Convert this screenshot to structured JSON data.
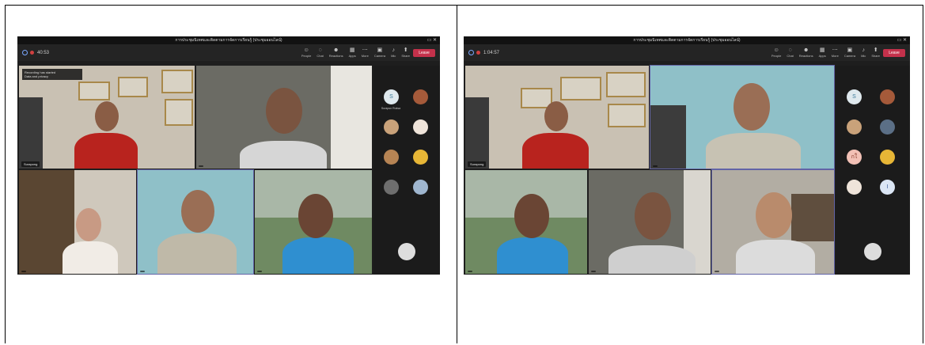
{
  "screens": [
    {
      "title_bar": "การประชุมนิเทศและติดตามการจัดการเรียนรู้ (ประชุมออนไลน์)",
      "timer": "40:53",
      "toolbar": {
        "items": [
          "People",
          "Chat",
          "Reactions",
          "Apps",
          "More",
          "Camera",
          "Mic",
          "Share"
        ],
        "leave_label": "Leave"
      },
      "notice": [
        "Recording has started",
        "Data and privacy"
      ],
      "tiles": [
        "Surapong",
        "",
        "",
        "",
        ""
      ],
      "sidebar": [
        {
          "initial": "S",
          "name": "Surapun Ruksa"
        },
        {
          "initial": "",
          "name": ""
        },
        {
          "initial": "",
          "name": ""
        },
        {
          "initial": "",
          "name": ""
        },
        {
          "initial": "",
          "name": ""
        },
        {
          "initial": "",
          "name": ""
        },
        {
          "initial": "",
          "name": ""
        },
        {
          "initial": "",
          "name": ""
        }
      ]
    },
    {
      "title_bar": "การประชุมนิเทศและติดตามการจัดการเรียนรู้ (ประชุมออนไลน์)",
      "timer": "1:04:57",
      "toolbar": {
        "items": [
          "People",
          "Chat",
          "Reactions",
          "Apps",
          "More",
          "Camera",
          "Mic",
          "Share"
        ],
        "leave_label": "Leave"
      },
      "tiles": [
        "Surapong",
        "",
        "",
        "",
        "",
        ""
      ],
      "sidebar": [
        {
          "initial": "S",
          "name": ""
        },
        {
          "initial": "",
          "name": ""
        },
        {
          "initial": "",
          "name": ""
        },
        {
          "initial": "",
          "name": ""
        },
        {
          "initial": "กใ",
          "name": ""
        },
        {
          "initial": "",
          "name": ""
        },
        {
          "initial": "",
          "name": ""
        },
        {
          "initial": "I",
          "name": ""
        }
      ]
    }
  ],
  "colors": {
    "leave": "#c4314b",
    "teams_accent": "#6264a7",
    "dark_bg": "#1e1e1e"
  }
}
